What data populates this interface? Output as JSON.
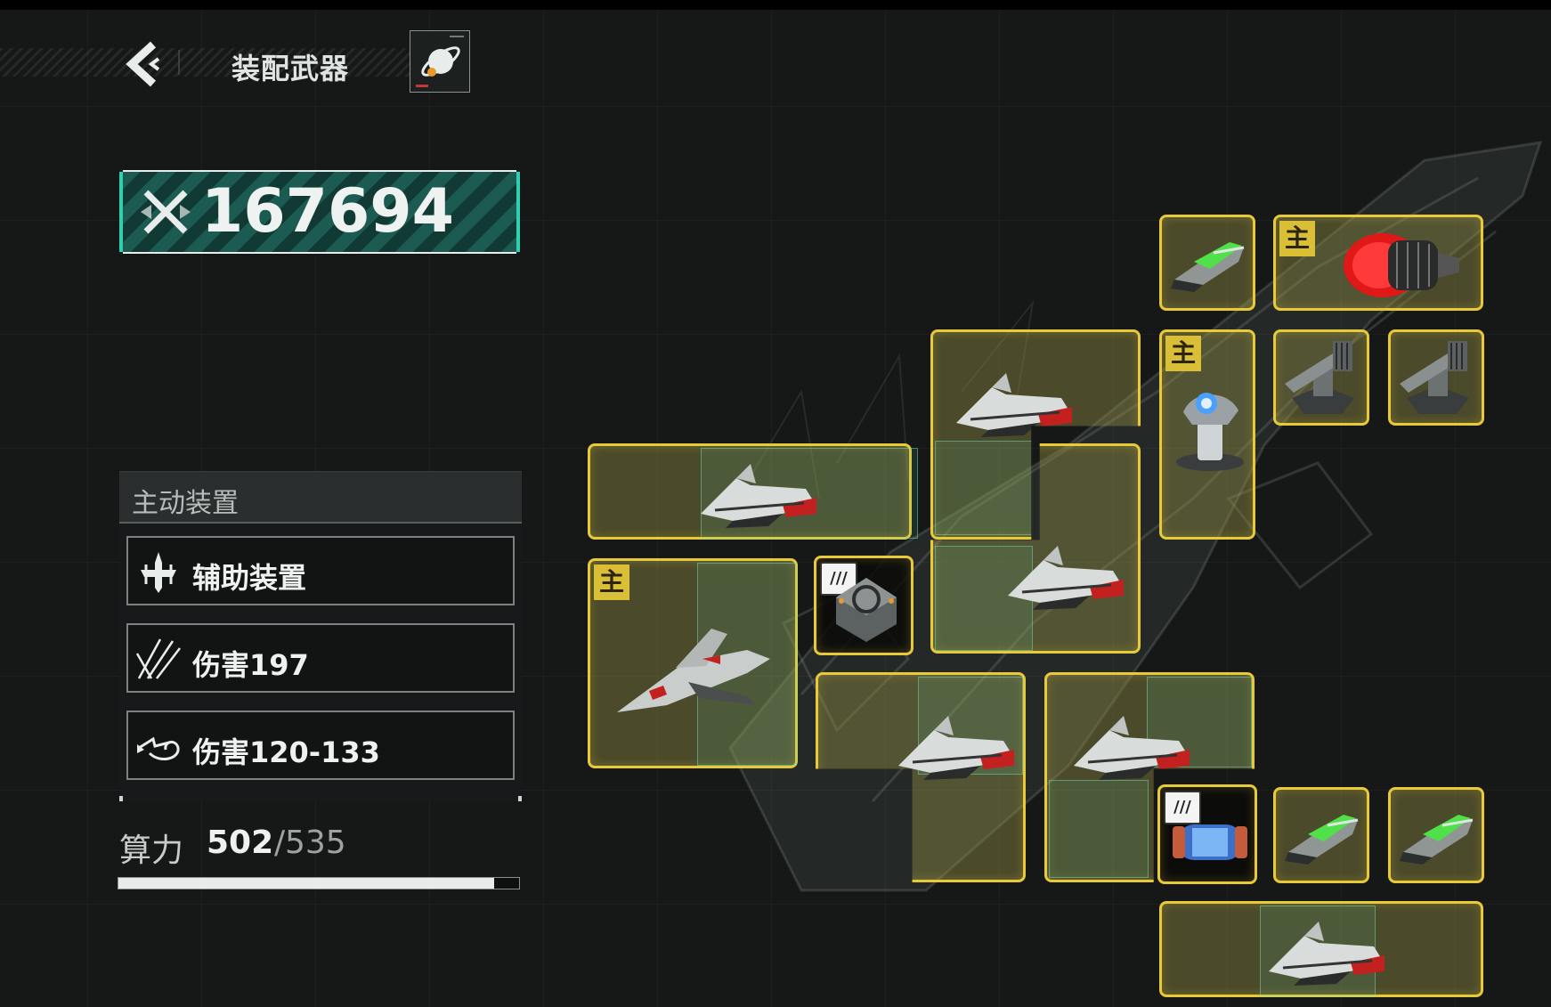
{
  "header": {
    "title": "装配武器",
    "back_icon": "chevron-left-icon",
    "planet_icon": "planet-icon"
  },
  "power": {
    "value": "167694",
    "icon": "crossed-swords-icon"
  },
  "active_device": {
    "title": "主动装置",
    "options": [
      {
        "label": "辅助装置",
        "icon": "drone-icon"
      },
      {
        "label": "伤害197",
        "icon": "slash-strike-icon"
      },
      {
        "label": "伤害120-133",
        "icon": "missile-swirl-icon"
      }
    ]
  },
  "compute": {
    "label": "算力",
    "used": "502",
    "separator": "/",
    "total": "535",
    "fraction": 0.938
  },
  "slots": {
    "main_badge": "主",
    "chip_badge": "///",
    "items": [
      {
        "kind": "green-cannon-icon"
      },
      {
        "kind": "red-engine-icon",
        "main": true
      },
      {
        "kind": "fighter-ship-icon"
      },
      {
        "kind": "radar-turret-icon",
        "main": true
      },
      {
        "kind": "gatling-turret-icon"
      },
      {
        "kind": "gatling-turret-icon"
      },
      {
        "kind": "fighter-ship-icon"
      },
      {
        "kind": "fighter-ship-icon"
      },
      {
        "kind": "jet-fighter-icon",
        "main": true
      },
      {
        "kind": "chip-module-icon"
      },
      {
        "kind": "fighter-ship-icon"
      },
      {
        "kind": "fighter-ship-icon"
      },
      {
        "kind": "energy-cell-icon"
      },
      {
        "kind": "green-cannon-icon"
      },
      {
        "kind": "green-cannon-icon"
      },
      {
        "kind": "fighter-ship-icon"
      }
    ]
  },
  "colors": {
    "accent_teal": "#2fd0b0",
    "slot_yellow": "#e8c93a",
    "badge_yellow": "#d9be36"
  }
}
